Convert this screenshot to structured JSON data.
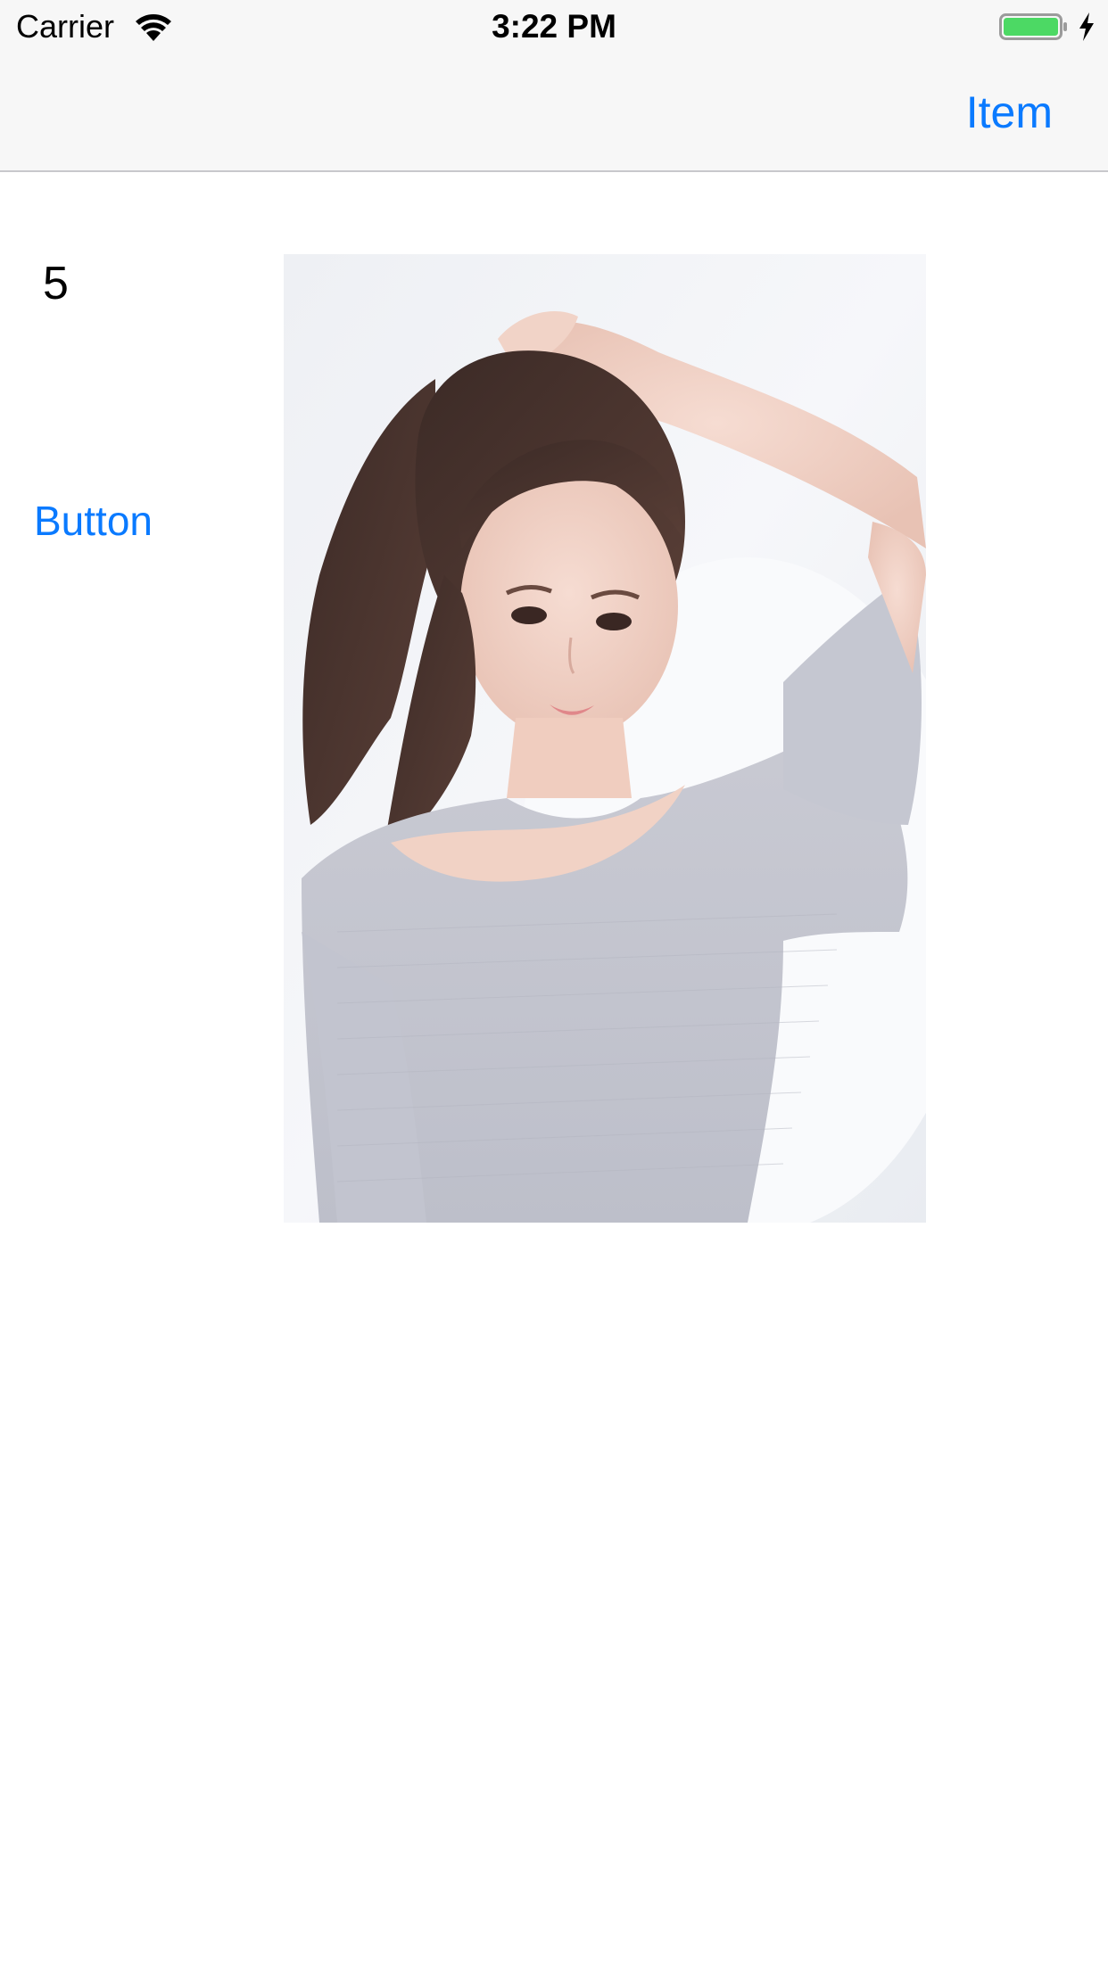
{
  "status_bar": {
    "carrier": "Carrier",
    "time": "3:22 PM",
    "wifi_icon": "wifi-icon",
    "battery_icon": "battery-icon",
    "charging_icon": "charging-bolt-icon",
    "battery_color": "#4cd964"
  },
  "nav_bar": {
    "right_item_label": "Item",
    "tint_color": "#0a7aff"
  },
  "content": {
    "counter_value": "5",
    "button_label": "Button",
    "photo_icon": "photo-image"
  }
}
